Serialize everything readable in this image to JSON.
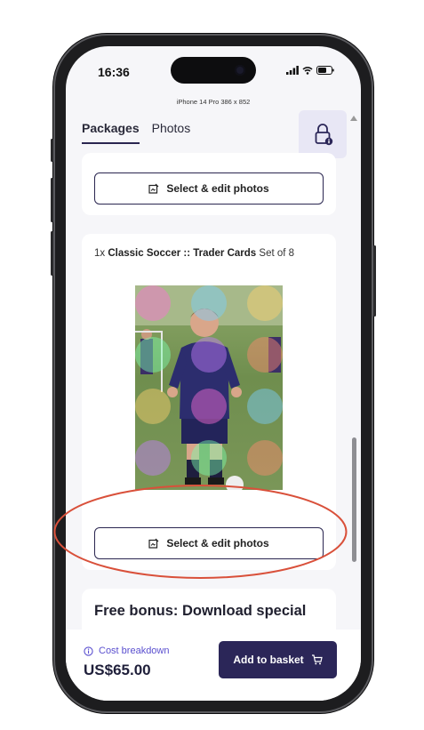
{
  "status_bar": {
    "time": "16:36"
  },
  "device_label": "iPhone 14 Pro  386 x 852",
  "tabs": [
    {
      "label": "Packages",
      "active": true
    },
    {
      "label": "Photos",
      "active": false
    }
  ],
  "card1": {
    "select_label": "Select & edit photos"
  },
  "card2": {
    "quantity": "1x",
    "product": "Classic Soccer :: Trader Cards",
    "set": "Set of 8",
    "select_label": "Select & edit photos"
  },
  "card3": {
    "title": "Free bonus: Download special"
  },
  "bottom_bar": {
    "cost_label": "Cost breakdown",
    "price": "US$65.00",
    "add_label": "Add to basket"
  },
  "colors": {
    "accent": "#2b2658",
    "link": "#5a4fcf",
    "annotation": "#d9503a"
  },
  "icons": [
    "lock-icon",
    "edit-photo-icon",
    "info-icon",
    "cart-icon",
    "signal-icon",
    "wifi-icon",
    "battery-icon"
  ]
}
